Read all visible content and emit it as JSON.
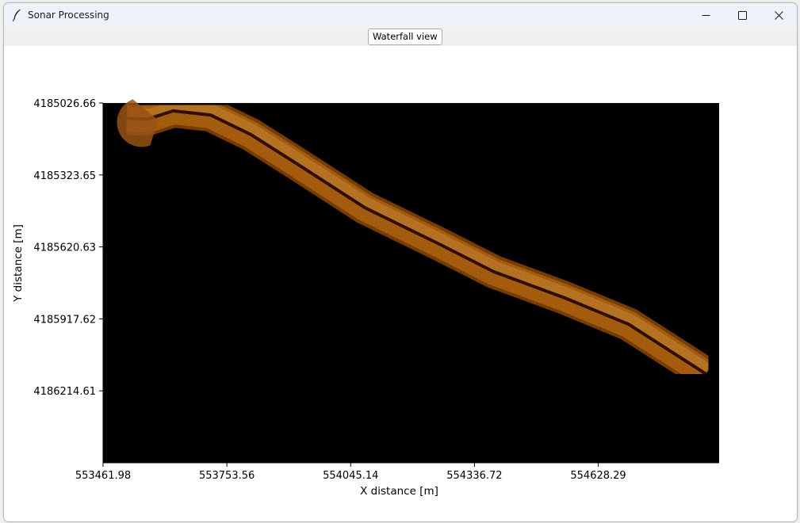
{
  "window": {
    "title": "Sonar Processing",
    "app_icon": "feather-icon",
    "controls": {
      "minimize": "minimize-icon",
      "maximize": "maximize-icon",
      "close": "close-icon"
    }
  },
  "toolbar": {
    "waterfall_label": "Waterfall view"
  },
  "chart_data": {
    "type": "heatmap",
    "title": "",
    "xlabel": "X distance [m]",
    "ylabel": "Y distance [m]",
    "xticks": [
      "553461.98",
      "553753.56",
      "554045.14",
      "554336.72",
      "554628.29"
    ],
    "xtick_values": [
      553461.98,
      553753.56,
      554045.14,
      554336.72,
      554628.29
    ],
    "yticks": [
      "4185026.66",
      "4185323.65",
      "4185620.63",
      "4185917.62",
      "4186214.61"
    ],
    "ytick_values": [
      4185026.66,
      4185323.65,
      4185620.63,
      4185917.62,
      4186214.61
    ],
    "xlim": [
      553461.98,
      554913.0
    ],
    "ylim": [
      4186511.6,
      4185026.66
    ],
    "y_inverted": true,
    "background_color": "#000000",
    "colormap": "copper",
    "grid": false,
    "track_centerline": [
      [
        553517.0,
        4185090.0
      ],
      [
        553567.0,
        4185093.0
      ],
      [
        553627.0,
        4185059.0
      ],
      [
        553715.0,
        4185076.0
      ],
      [
        553810.0,
        4185157.0
      ],
      [
        553922.0,
        4185281.0
      ],
      [
        554079.0,
        4185459.0
      ],
      [
        554254.0,
        4185609.0
      ],
      [
        554382.0,
        4185723.0
      ],
      [
        554548.0,
        4185830.0
      ],
      [
        554700.0,
        4185940.0
      ],
      [
        554882.0,
        4186145.0
      ]
    ]
  }
}
